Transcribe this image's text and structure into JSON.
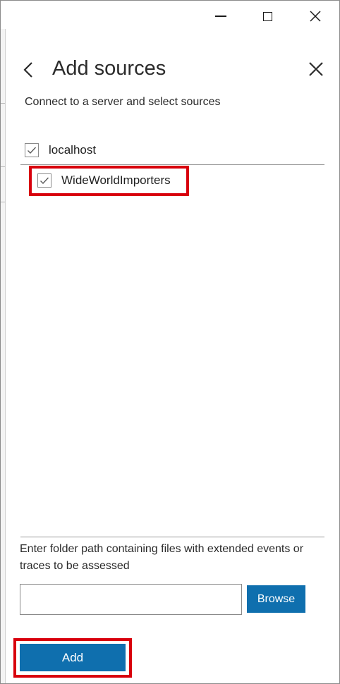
{
  "window": {
    "controls": {
      "minimize_icon": "minimize-icon",
      "maximize_icon": "maximize-icon",
      "close_icon": "close-icon"
    }
  },
  "panel": {
    "title": "Add sources",
    "back_icon": "chevron-left-icon",
    "close_icon": "close-icon",
    "subtitle": "Connect to a server and select sources"
  },
  "tree": {
    "server": {
      "label": "localhost",
      "checked": true
    },
    "databases": [
      {
        "label": "WideWorldImporters",
        "checked": true
      }
    ]
  },
  "folder": {
    "hint": "Enter folder path containing files with extended events or traces to be assessed",
    "value": "",
    "browse_label": "Browse"
  },
  "footer": {
    "add_label": "Add"
  },
  "colors": {
    "accent": "#0f6fae",
    "highlight": "#d8000c"
  }
}
